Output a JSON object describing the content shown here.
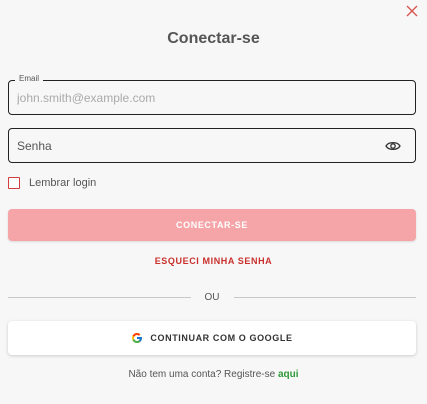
{
  "dialog": {
    "title": "Conectar-se",
    "close_icon": "close-icon"
  },
  "email": {
    "label": "Email",
    "placeholder": "john.smith@example.com",
    "value": ""
  },
  "password": {
    "placeholder": "Senha",
    "value": "",
    "toggle_icon": "eye-icon"
  },
  "remember": {
    "label": "Lembrar login",
    "checked": false
  },
  "buttons": {
    "connect": "CONECTAR-SE",
    "forgot": "ESQUECI MINHA SENHA",
    "google": "CONTINUAR COM O GOOGLE"
  },
  "divider": {
    "text": "OU"
  },
  "register": {
    "text": "Não tem uma conta? Registre-se",
    "link": "aqui"
  },
  "colors": {
    "primary_button": "#f5a5a8",
    "accent_red": "#c9302c",
    "link_green": "#2e9a3a",
    "background": "#f7f7f7"
  }
}
